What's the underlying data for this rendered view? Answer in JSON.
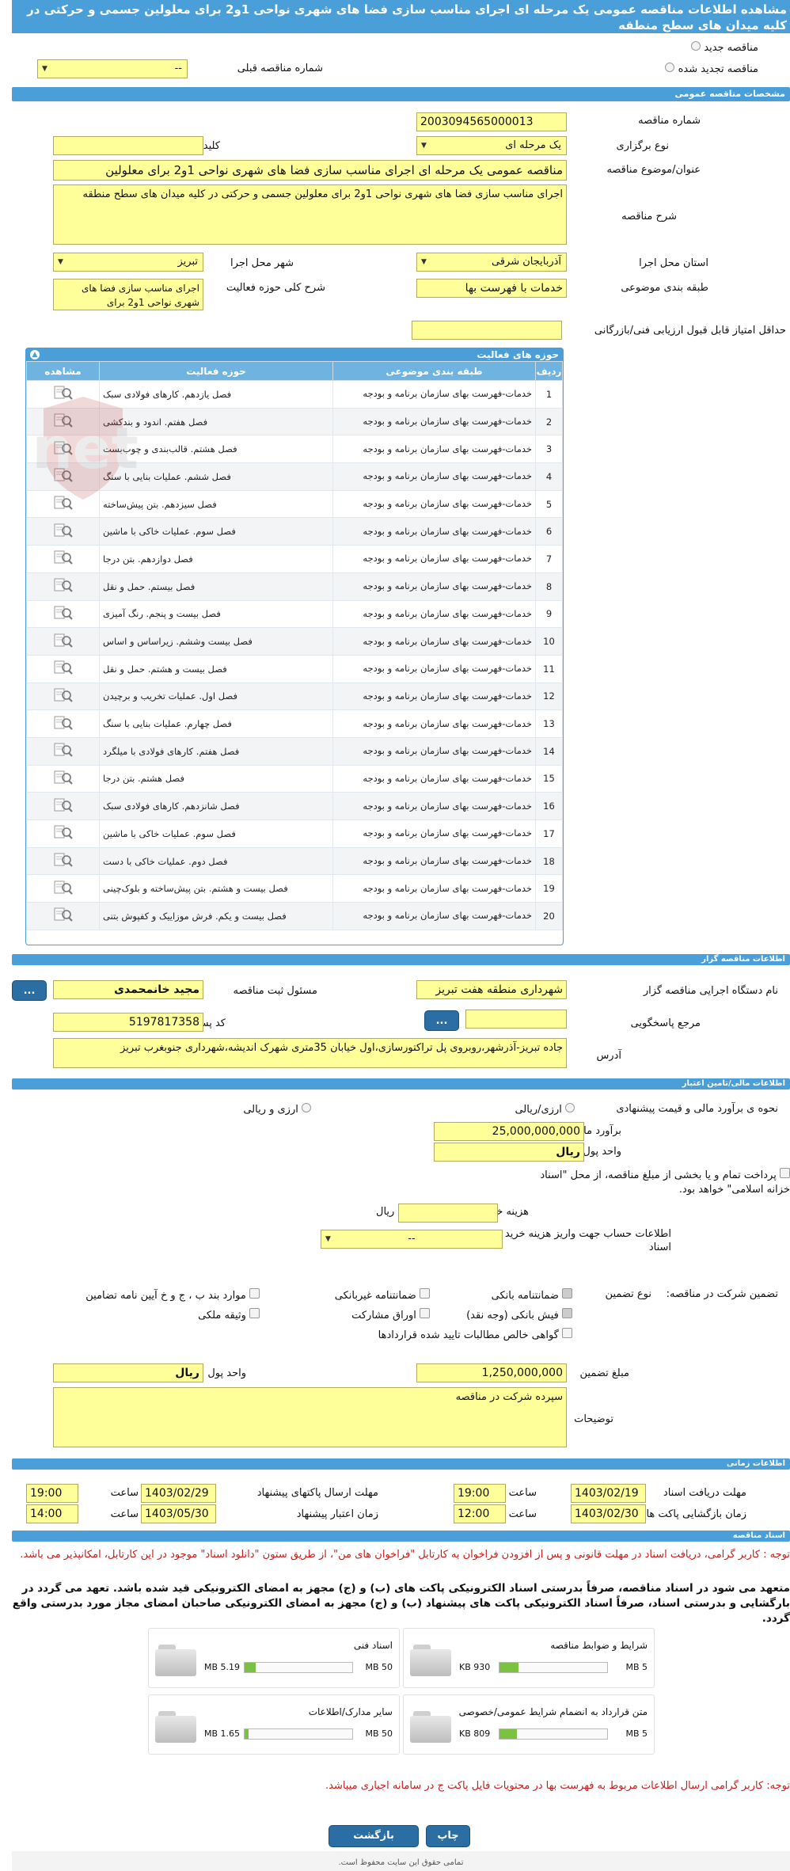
{
  "page_title": "مشاهده اطلاعات مناقصه عمومی یک مرحله ای اجرای مناسب سازی فضا های شهری نواحی 1و2 برای معلولین جسمی و حرکتی در کلیه میدان های سطح منطقه",
  "radios": {
    "new": "مناقصه جدید",
    "renew": "مناقصه تجدید شده",
    "prev_number_label": "شماره مناقصه قبلی",
    "prev_number_value": "--"
  },
  "general": {
    "header": "مشخصات مناقصه عمومی",
    "number_label": "شماره مناقصه",
    "number_value": "2003094565000013",
    "type_label": "نوع برگزاری",
    "type_value": "یک مرحله ای",
    "keyword_label": "کلید واژه",
    "keyword_value": "",
    "subject_label": "عنوان/موضوع مناقصه",
    "subject_value": "مناقصه عمومی یک مرحله ای اجرای مناسب سازی فضا های شهری نواحی 1و2 برای معلولین",
    "desc_label": "شرح مناقصه",
    "desc_value": "اجرای مناسب سازی فضا های شهری نواحی 1و2 برای معلولین جسمی و حرکتی در کلیه میدان های سطح منطقه",
    "province_label": "استان محل اجرا",
    "province_value": "آذربایجان شرقی",
    "city_label": "شهر محل اجرا",
    "city_value": "تبریز",
    "category_label": "طبقه بندی موضوعی",
    "category_value": "خدمات با فهرست بها",
    "scope_label": "شرح کلی حوزه فعالیت",
    "scope_value": "اجرای مناسب سازی فضا های شهری نواحی 1و2 برای",
    "min_score_label": "حداقل امتیاز قابل قبول ارزیابی فنی/بازرگانی",
    "min_score_value": ""
  },
  "activities": {
    "title": "حوزه های فعالیت",
    "columns": [
      "ردیف",
      "طبقه بندی موضوعی",
      "حوزه فعالیت",
      "مشاهده"
    ],
    "category_text": "خدمات-فهرست بهای سازمان برنامه و بودجه",
    "rows": [
      {
        "n": "1",
        "activity": "فصل یازدهم. کارهای فولادی سبک"
      },
      {
        "n": "2",
        "activity": "فصل هفتم. اندود و بندکشی"
      },
      {
        "n": "3",
        "activity": "فصل هشتم. قالب‌بندی و چوب‌بست"
      },
      {
        "n": "4",
        "activity": "فصل ششم. عملیات بنایی با سنگ"
      },
      {
        "n": "5",
        "activity": "فصل سیزدهم. بتن پیش‌ساخته"
      },
      {
        "n": "6",
        "activity": "فصل سوم. عملیات خاکی با ماشین"
      },
      {
        "n": "7",
        "activity": "فصل دوازدهم. بتن درجا"
      },
      {
        "n": "8",
        "activity": "فصل بیستم. حمل و نقل"
      },
      {
        "n": "9",
        "activity": "فصل بیست و پنجم. رنگ آمیزی"
      },
      {
        "n": "10",
        "activity": "فصل بیست وششم. زیراساس و اساس"
      },
      {
        "n": "11",
        "activity": "فصل بیست و هشتم. حمل و نقل"
      },
      {
        "n": "12",
        "activity": "فصل اول. عملیات تخریب و برچیدن"
      },
      {
        "n": "13",
        "activity": "فصل چهارم. عملیات بنایی با سنگ"
      },
      {
        "n": "14",
        "activity": "فصل هفتم. کارهای فولادی با میلگرد"
      },
      {
        "n": "15",
        "activity": "فصل هشتم. بتن درجا"
      },
      {
        "n": "16",
        "activity": "فصل شانزدهم. کارهای فولادی سبک"
      },
      {
        "n": "17",
        "activity": "فصل سوم. عملیات خاکی با ماشین"
      },
      {
        "n": "18",
        "activity": "فصل دوم. عملیات خاکی با دست"
      },
      {
        "n": "19",
        "activity": "فصل بیست و هشتم. بتن پیش‌ساخته و بلوک‌چینی"
      },
      {
        "n": "20",
        "activity": "فصل بیست و یکم. فرش موزاییک و کفپوش بتنی"
      }
    ]
  },
  "organizer": {
    "header": "اطلاعات مناقصه گزار",
    "org_label": "نام دستگاه اجرایی مناقصه گزار",
    "org_value": "شهرداری منطقه هفت تبریز",
    "resp_label": "مسئول ثبت مناقصه",
    "resp_value": "مجید خانمحمدی",
    "ref_label": "مرجع پاسخگویی",
    "ref_value": "",
    "postal_label": "کد پستی",
    "postal_value": "5197817358",
    "addr_label": "آدرس",
    "addr_value": "جاده تبریز-آذرشهر،روبروی پل تراکتورسازی،اول خیابان 35متری شهرک اندیشه،شهرداری جنوبغرب تبریز",
    "dots": "..."
  },
  "finance": {
    "header": "اطلاعات مالی/تامین اعتبار",
    "method_label": "نحوه ی برآورد مالی و قیمت پیشنهادی",
    "opt1": "ارزی/ریالی",
    "opt2": "ارزی و ریالی",
    "estimate_label": "برآورد مالی",
    "estimate_value": "25,000,000,000",
    "unit_label": "واحد پول",
    "unit_value": "ریال",
    "treasury_text": "پرداخت تمام و یا بخشی از مبلغ مناقصه، از محل \"اسناد خزانه اسلامی\" خواهد بود.",
    "doc_cost_label": "هزینه خرید اسناد",
    "doc_cost_unit": "ریال",
    "doc_cost_value": "",
    "account_label": "اطلاعات حساب جهت واریز هزینه خرید اسناد",
    "account_value": "--"
  },
  "guarantee": {
    "participation_label": "تضمین شرکت در مناقصه:",
    "type_label": "نوع تضمین",
    "opts": [
      "ضمانتنامه بانکی",
      "ضمانتنامه غیربانکی",
      "موارد بند ب ، ج و خ آیین نامه تضامین",
      "فیش بانکی (وجه نقد)",
      "اوراق مشارکت",
      "وثیقه ملکی",
      "گواهی خالص مطالبات تایید شده قراردادها"
    ],
    "amount_label": "مبلغ تضمین",
    "amount_value": "1,250,000,000",
    "unit_label": "واحد پول",
    "unit_value": "ریال",
    "notes_label": "توضیحات",
    "notes_value": "سپرده شرکت در مناقصه"
  },
  "timing": {
    "header": "اطلاعات زمانی",
    "receive_label": "مهلت دریافت اسناد",
    "receive_date": "1403/02/19",
    "receive_time": "19:00",
    "send_label": "مهلت ارسال پاکتهای پیشنهاد",
    "send_date": "1403/02/29",
    "send_time": "19:00",
    "open_label": "زمان بازگشایی پاکت ها",
    "open_date": "1403/02/30",
    "open_time": "12:00",
    "valid_label": "زمان اعتبار پیشنهاد",
    "valid_date": "1403/05/30",
    "valid_time": "14:00",
    "time_label": "ساعت"
  },
  "documents": {
    "header": "اسناد مناقصه",
    "notice1": "توجه : کاربر گرامی، دریافت اسناد در مهلت قانونی و پس از افزودن فراخوان به کارتابل \"فراخوان های من\"، از طریق ستون \"دانلود اسناد\" موجود در این کارتابل، امکانپذیر می باشد.",
    "notice2": "متعهد می شود در اسناد مناقصه، صرفاً بدرستی اسناد الکترونیکی پاکت های (ب) و (ج) مجهز به امضای الکترونیکی قید شده باشد. تعهد می گردد در بارگشایی و بدرستی اسناد، صرفاً اسناد الکترونیکی پاکت های پیشنهاد (ب) و (ج) مجهز به امضای الکترونیکی صاحبان امضای مجاز مورد بدرستی واقع گردد.",
    "files": [
      {
        "name": "شرایط و ضوابط مناقصه",
        "used": "930 KB",
        "max": "5 MB",
        "fill": 0.18
      },
      {
        "name": "اسناد فنی",
        "used": "5.19 MB",
        "max": "50 MB",
        "fill": 0.1
      },
      {
        "name": "متن قرارداد به انضمام شرایط عمومی/خصوصی",
        "used": "809 KB",
        "max": "5 MB",
        "fill": 0.16
      },
      {
        "name": "سایر مدارک/اطلاعات",
        "used": "1.65 MB",
        "max": "50 MB",
        "fill": 0.04
      }
    ],
    "notice3": "توجه: کاربر گرامی ارسال اطلاعات مربوط به فهرست بها در محتویات فایل پاکت ج در سامانه اجباری میباشد."
  },
  "buttons": {
    "print": "چاپ",
    "back": "بازگشت"
  },
  "footer": "تمامی حقوق این سایت محفوظ است.",
  "watermark": "AriaTender.net",
  "colors": {
    "header": "#4a9fd8",
    "field": "#ffff99",
    "button": "#2b6ea4",
    "notice": "#cc1b1b"
  },
  "icons": {
    "view": "magnifier-doc-icon",
    "folder": "folder-icon",
    "collapse": "collapse-icon"
  }
}
